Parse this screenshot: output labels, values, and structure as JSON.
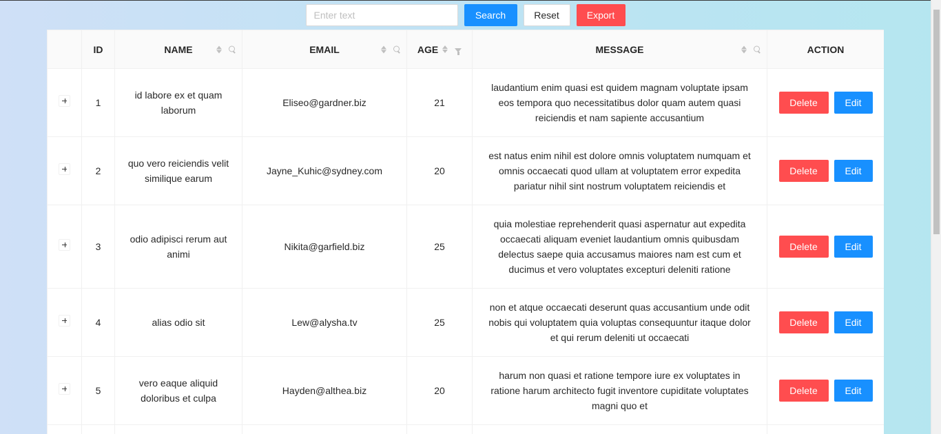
{
  "toolbar": {
    "search_placeholder": "Enter text",
    "search_value": "",
    "search_label": "Search",
    "reset_label": "Reset",
    "export_label": "Export"
  },
  "table": {
    "columns": {
      "id": "ID",
      "name": "NAME",
      "email": "EMAIL",
      "age": "AGE",
      "message": "MESSAGE",
      "action": "ACTION"
    },
    "action_labels": {
      "delete": "Delete",
      "edit": "Edit"
    },
    "rows": [
      {
        "id": "1",
        "name": "id labore ex et quam laborum",
        "email": "Eliseo@gardner.biz",
        "age": "21",
        "message": "laudantium enim quasi est quidem magnam voluptate ipsam eos tempora quo necessitatibus dolor quam autem quasi reiciendis et nam sapiente accusantium"
      },
      {
        "id": "2",
        "name": "quo vero reiciendis velit similique earum",
        "email": "Jayne_Kuhic@sydney.com",
        "age": "20",
        "message": "est natus enim nihil est dolore omnis voluptatem numquam et omnis occaecati quod ullam at voluptatem error expedita pariatur nihil sint nostrum voluptatem reiciendis et"
      },
      {
        "id": "3",
        "name": "odio adipisci rerum aut animi",
        "email": "Nikita@garfield.biz",
        "age": "25",
        "message": "quia molestiae reprehenderit quasi aspernatur aut expedita occaecati aliquam eveniet laudantium omnis quibusdam delectus saepe quia accusamus maiores nam est cum et ducimus et vero voluptates excepturi deleniti ratione"
      },
      {
        "id": "4",
        "name": "alias odio sit",
        "email": "Lew@alysha.tv",
        "age": "25",
        "message": "non et atque occaecati deserunt quas accusantium unde odit nobis qui voluptatem quia voluptas consequuntur itaque dolor et qui rerum deleniti ut occaecati"
      },
      {
        "id": "5",
        "name": "vero eaque aliquid doloribus et culpa",
        "email": "Hayden@althea.biz",
        "age": "20",
        "message": "harum non quasi et ratione tempore iure ex voluptates in ratione harum architecto fugit inventore cupiditate voluptates magni quo et"
      }
    ]
  },
  "colors": {
    "primary": "#1890ff",
    "danger": "#ff4d4f",
    "header_bg": "#fafafa",
    "border": "#f0f0f0"
  }
}
